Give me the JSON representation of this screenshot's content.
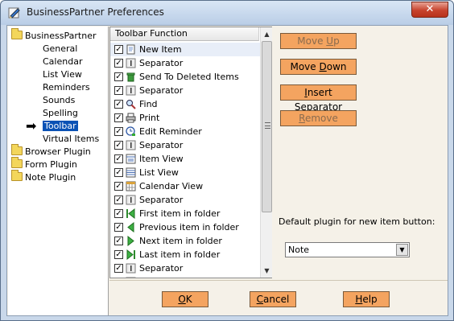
{
  "window": {
    "title": "BusinessPartner Preferences",
    "close_glyph": "✕"
  },
  "tree": {
    "items": [
      {
        "label": "BusinessPartner",
        "type": "folder",
        "level": 0
      },
      {
        "label": "General",
        "type": "leaf",
        "level": 1
      },
      {
        "label": "Calendar",
        "type": "leaf",
        "level": 1
      },
      {
        "label": "List View",
        "type": "leaf",
        "level": 1
      },
      {
        "label": "Reminders",
        "type": "leaf",
        "level": 1
      },
      {
        "label": "Sounds",
        "type": "leaf",
        "level": 1
      },
      {
        "label": "Spelling",
        "type": "leaf",
        "level": 1
      },
      {
        "label": "Toolbar",
        "type": "leaf",
        "level": 1,
        "selected": true
      },
      {
        "label": "Virtual Items",
        "type": "leaf",
        "level": 1
      },
      {
        "label": "Browser Plugin",
        "type": "folder",
        "level": 0
      },
      {
        "label": "Form Plugin",
        "type": "folder",
        "level": 0
      },
      {
        "label": "Note Plugin",
        "type": "folder",
        "level": 0
      }
    ],
    "selection_arrow": "➡"
  },
  "toolbar_functions": {
    "header": "Toolbar Function",
    "items": [
      {
        "label": "New Item",
        "checked": true,
        "icon": "new-item-icon",
        "selected": true
      },
      {
        "label": "Separator",
        "checked": true,
        "icon": "separator-icon"
      },
      {
        "label": "Send To Deleted Items",
        "checked": true,
        "icon": "trash-icon"
      },
      {
        "label": "Separator",
        "checked": true,
        "icon": "separator-icon"
      },
      {
        "label": "Find",
        "checked": true,
        "icon": "magnifier-icon"
      },
      {
        "label": "Print",
        "checked": true,
        "icon": "printer-icon"
      },
      {
        "label": "Edit Reminder",
        "checked": true,
        "icon": "reminder-icon"
      },
      {
        "label": "Separator",
        "checked": true,
        "icon": "separator-icon"
      },
      {
        "label": "Item View",
        "checked": true,
        "icon": "item-view-icon"
      },
      {
        "label": "List View",
        "checked": true,
        "icon": "list-view-icon"
      },
      {
        "label": "Calendar View",
        "checked": true,
        "icon": "calendar-view-icon"
      },
      {
        "label": "Separator",
        "checked": true,
        "icon": "separator-icon"
      },
      {
        "label": "First item in folder",
        "checked": true,
        "icon": "first-item-icon"
      },
      {
        "label": "Previous item in folder",
        "checked": true,
        "icon": "previous-item-icon"
      },
      {
        "label": "Next item in folder",
        "checked": true,
        "icon": "next-item-icon"
      },
      {
        "label": "Last item in folder",
        "checked": true,
        "icon": "last-item-icon"
      },
      {
        "label": "Separator",
        "checked": true,
        "icon": "separator-icon"
      },
      {
        "label": "",
        "checked": true,
        "icon": "separator-icon"
      }
    ],
    "check_glyph": "✓"
  },
  "actions": {
    "move_up": {
      "pre": "Move ",
      "key": "U",
      "post": "p",
      "enabled": false
    },
    "move_down": {
      "pre": "Move ",
      "key": "D",
      "post": "own",
      "enabled": true
    },
    "insert_separator": {
      "pre": "",
      "key": "I",
      "post": "nsert Separator",
      "enabled": true
    },
    "remove": {
      "pre": "",
      "key": "R",
      "post": "emove",
      "enabled": false
    }
  },
  "default_plugin": {
    "label": "Default plugin for new item button:",
    "value": "Note"
  },
  "dialog_buttons": {
    "ok": {
      "pre": "",
      "key": "O",
      "post": "K"
    },
    "cancel": {
      "pre": "",
      "key": "C",
      "post": "ancel"
    },
    "help": {
      "pre": "",
      "key": "H",
      "post": "elp"
    }
  },
  "colors": {
    "button_bg": "#f4a460",
    "panel_bg": "#f5f1e8",
    "selection": "#0a52b5"
  }
}
